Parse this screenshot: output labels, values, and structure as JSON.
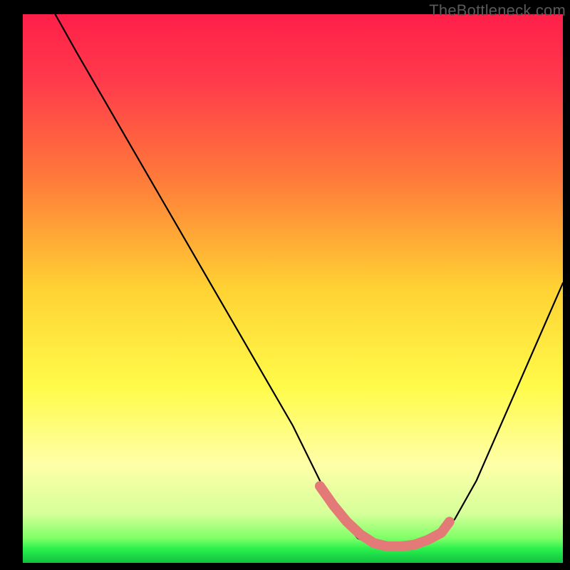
{
  "watermark": "TheBottleneck.com",
  "colors": {
    "frame": "#000000",
    "curve": "#000000",
    "thick_segment": "#e47a77",
    "gradient_stops": [
      {
        "offset": 0.0,
        "color": "#ff1f4a"
      },
      {
        "offset": 0.12,
        "color": "#ff3a4b"
      },
      {
        "offset": 0.3,
        "color": "#ff7a3a"
      },
      {
        "offset": 0.5,
        "color": "#ffd233"
      },
      {
        "offset": 0.68,
        "color": "#fffb4a"
      },
      {
        "offset": 0.82,
        "color": "#ffffa8"
      },
      {
        "offset": 0.91,
        "color": "#d6ff9a"
      },
      {
        "offset": 0.955,
        "color": "#7fff66"
      },
      {
        "offset": 0.975,
        "color": "#29f04d"
      },
      {
        "offset": 1.0,
        "color": "#10c040"
      }
    ]
  },
  "chart_data": {
    "type": "line",
    "title": "",
    "xlabel": "",
    "ylabel": "",
    "xlim": [
      0,
      100
    ],
    "ylim": [
      0,
      100
    ],
    "series": [
      {
        "name": "bottleneck-curve",
        "x": [
          6,
          10,
          15,
          20,
          25,
          30,
          35,
          40,
          45,
          50,
          53,
          56,
          59,
          62,
          65,
          68,
          71,
          74,
          77,
          80,
          84,
          88,
          92,
          96,
          100
        ],
        "values": [
          100,
          93,
          84.5,
          76,
          67.5,
          59,
          50.5,
          42,
          33.5,
          25,
          19,
          13,
          8,
          4.5,
          3.2,
          3.0,
          3.0,
          3.2,
          4.5,
          8,
          15,
          24,
          33,
          42,
          51
        ]
      }
    ],
    "highlight_segment": {
      "x": [
        55,
        57.5,
        60,
        62.5,
        65,
        67.5,
        70,
        72.5,
        75,
        77.5,
        79
      ],
      "values": [
        14,
        10.5,
        7.5,
        5.2,
        3.6,
        3.0,
        3.0,
        3.3,
        4.2,
        5.5,
        7.5
      ]
    }
  }
}
